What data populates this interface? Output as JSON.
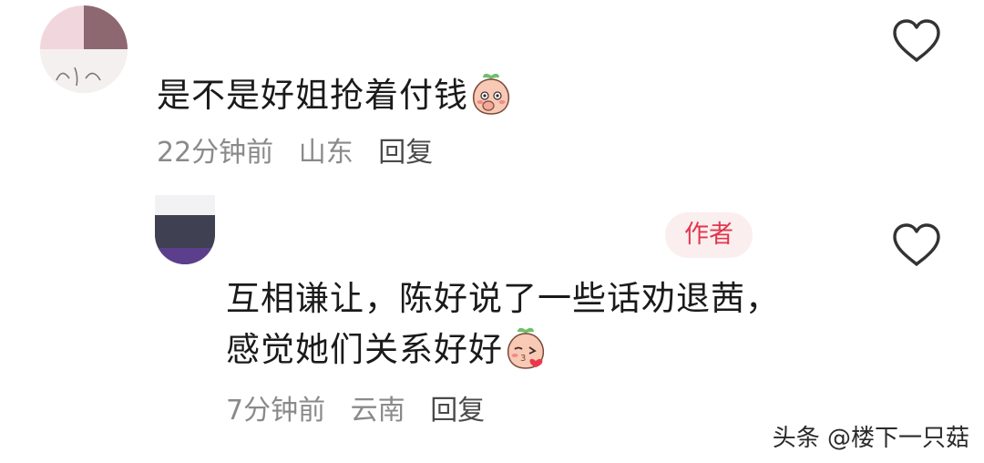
{
  "comments": [
    {
      "text": "是不是好姐抢着付钱",
      "emoji": "peach-shy-emoji",
      "time": "22分钟前",
      "location": "山东",
      "reply_label": "回复",
      "like_icon": "heart-outline-icon"
    },
    {
      "badge": "作者",
      "text_line1": "互相谦让，陈好说了一些话劝退茜，",
      "text_line2": "感觉她们关系好好",
      "emoji": "peach-kiss-emoji",
      "time": "7分钟前",
      "location": "云南",
      "reply_label": "回复",
      "like_icon": "heart-outline-icon"
    }
  ],
  "watermark": "头条 @楼下一只菇",
  "colors": {
    "text": "#1a1a1a",
    "meta": "#8a8a8a",
    "badge_text": "#e0384d",
    "badge_bg": "#fbeeee"
  }
}
